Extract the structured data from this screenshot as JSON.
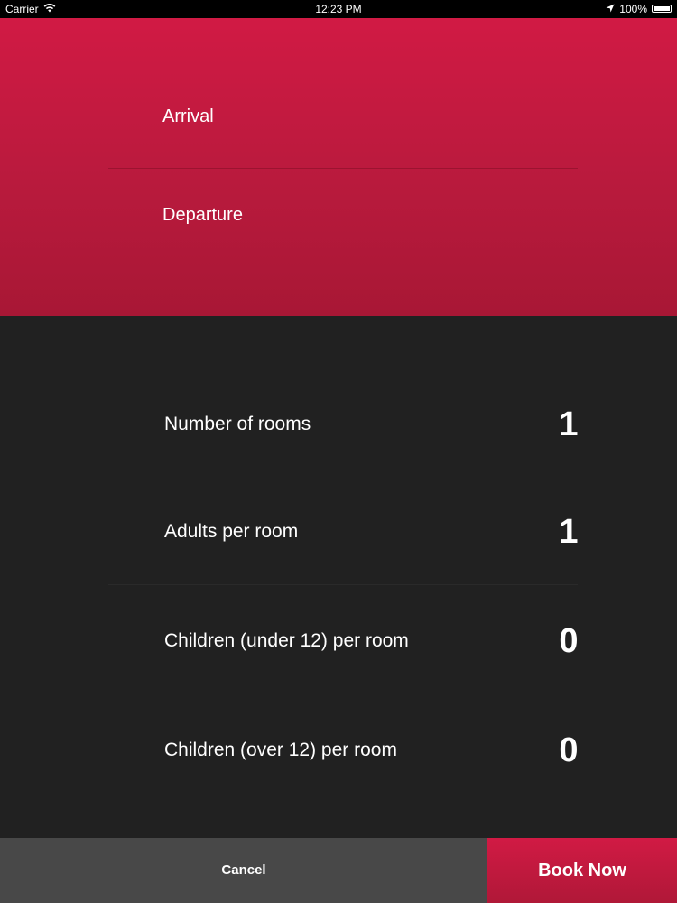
{
  "status_bar": {
    "carrier": "Carrier",
    "time": "12:23 PM",
    "battery": "100%",
    "battery_level": 1.0,
    "icons": [
      "wifi-icon",
      "location-arrow-icon",
      "battery-icon"
    ]
  },
  "dates": {
    "arrival_label": "Arrival",
    "departure_label": "Departure"
  },
  "guests": {
    "rows": [
      {
        "label": "Number of rooms",
        "value": "1"
      },
      {
        "label": "Adults per room",
        "value": "1"
      },
      {
        "label": "Children (under 12) per room",
        "value": "0"
      },
      {
        "label": "Children (over 12) per room",
        "value": "0"
      }
    ]
  },
  "actions": {
    "cancel_label": "Cancel",
    "book_label": "Book Now"
  },
  "colors": {
    "accent": "#c8193f",
    "background": "#212121",
    "cancel_bar": "#484848",
    "text": "#ffffff"
  }
}
